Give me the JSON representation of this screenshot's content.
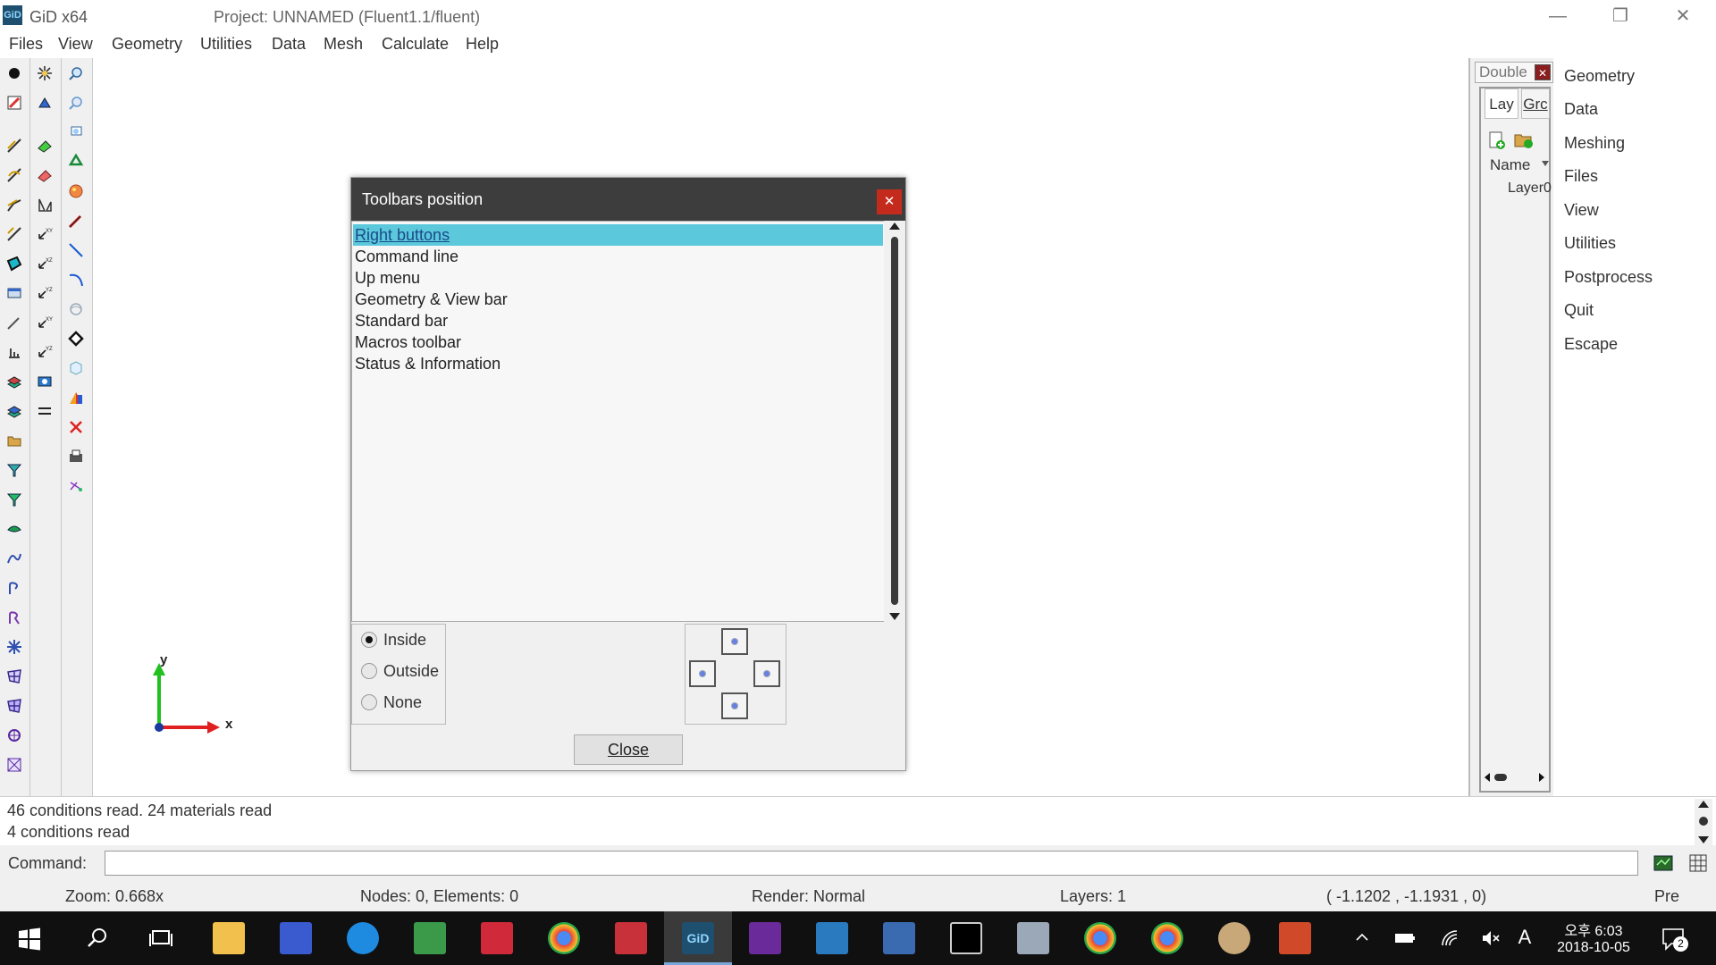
{
  "window": {
    "app_icon_label": "GiD",
    "app_title": "GiD x64",
    "project_title": "Project: UNNAMED (Fluent1.1/fluent)",
    "minimize_glyph": "—",
    "restore_glyph": "❐",
    "close_glyph": "✕"
  },
  "menu": [
    "Files",
    "View",
    "Geometry",
    "Utilities",
    "Data",
    "Mesh",
    "Calculate",
    "Help"
  ],
  "left_toolbar_icons": [
    "point-icon",
    "pencil-icon",
    "line-icon",
    "arc-icon",
    "polyline-icon",
    "nurbs-icon",
    "surface-icon",
    "volume-icon",
    "dimension-icon",
    "measure-icon",
    "layers-icon",
    "layers2-icon",
    "folder-icon",
    "mesh-funnel-icon",
    "mesh-funnel2-icon",
    "surface-green-icon",
    "curve-icon",
    "spline-icon",
    "spline2-icon",
    "star-icon",
    "quad-mesh-icon",
    "quad-mesh2-icon",
    "mesh-sphere-icon",
    "mesh-sphere2-icon"
  ],
  "right_panel": {
    "combo_value": "Double",
    "tabs": [
      "Lay",
      "Grc"
    ],
    "column_header": "Name",
    "layer_name": "Layer0"
  },
  "right_buttons": [
    "Geometry",
    "Data",
    "Meshing",
    "Files",
    "View",
    "Utilities",
    "Postprocess",
    "Quit",
    "Escape"
  ],
  "dialog": {
    "title": "Toolbars position",
    "close_glyph": "✕",
    "items": [
      "Right buttons",
      "Command line",
      "Up menu",
      "Geometry & View bar",
      "Standard bar",
      "Macros toolbar",
      "Status & Information"
    ],
    "selected_index": 0,
    "radio": [
      "Inside",
      "Outside",
      "None"
    ],
    "radio_selected": "Inside",
    "close_button": "Close"
  },
  "axes": {
    "x_label": "x",
    "y_label": "y"
  },
  "messages": [
    "46 conditions read. 24 materials read",
    "4 conditions read"
  ],
  "command": {
    "label": "Command:",
    "value": ""
  },
  "status": {
    "zoom": "Zoom: 0.668x",
    "nodes": "Nodes: 0, Elements: 0",
    "render": "Render: Normal",
    "layers": "Layers: 1",
    "coords": "( -1.1202 , -1.1931 ,  0)",
    "pre": "Pre"
  },
  "taskbar": {
    "time_prefix": "오후",
    "time": "6:03",
    "date": "2018-10-05",
    "ime": "A",
    "notifications": "2"
  },
  "colors": {
    "selection": "#5bc8dc",
    "dialog_title": "#3d3d3d",
    "dialog_close": "#c42b1c",
    "axis_x": "#e02020",
    "axis_y": "#20c020",
    "taskbar": "#101010"
  }
}
